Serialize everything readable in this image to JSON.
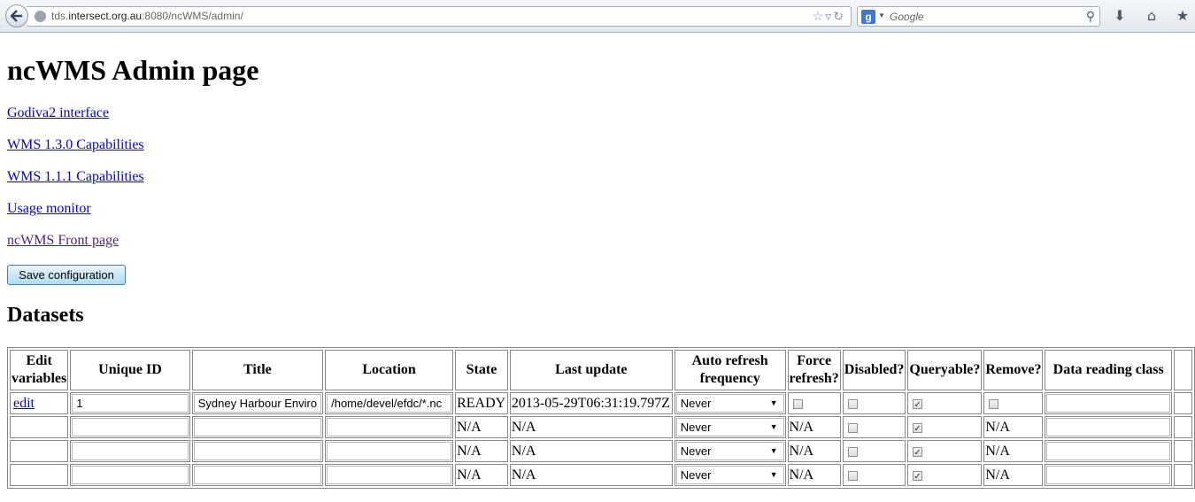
{
  "browser": {
    "url_prefix": "tds.",
    "url_host": "intersect.org.au",
    "url_rest": ":8080/ncWMS/admin/",
    "search_placeholder": "Google",
    "search_engine_letter": "g"
  },
  "page": {
    "title": "ncWMS Admin page",
    "links": [
      {
        "label": "Godiva2 interface"
      },
      {
        "label": "WMS 1.3.0 Capabilities"
      },
      {
        "label": "WMS 1.1.1 Capabilities"
      },
      {
        "label": "Usage monitor"
      },
      {
        "label": "ncWMS Front page"
      }
    ],
    "save_button": "Save configuration",
    "datasets_heading": "Datasets"
  },
  "table": {
    "headers": {
      "edit_line1": "Edit",
      "edit_line2": "variables",
      "unique_id": "Unique ID",
      "title": "Title",
      "location": "Location",
      "state": "State",
      "last_update": "Last update",
      "auto_line1": "Auto refresh",
      "auto_line2": "frequency",
      "force_line1": "Force",
      "force_line2": "refresh?",
      "disabled": "Disabled?",
      "queryable": "Queryable?",
      "remove": "Remove?",
      "data_class": "Data reading class"
    },
    "rows": [
      {
        "edit": "edit",
        "unique_id": "1",
        "title": "Sydney Harbour Enviro",
        "location": "/home/devel/efdc/*.nc",
        "state": "READY",
        "last_update": "2013-05-29T06:31:19.797Z",
        "refresh": "Never",
        "force": "",
        "disabled": false,
        "queryable": true,
        "remove": ""
      },
      {
        "edit": "",
        "unique_id": "",
        "title": "",
        "location": "",
        "state": "N/A",
        "last_update": "N/A",
        "refresh": "Never",
        "force": "N/A",
        "disabled": false,
        "queryable": true,
        "remove": "N/A"
      },
      {
        "edit": "",
        "unique_id": "",
        "title": "",
        "location": "",
        "state": "N/A",
        "last_update": "N/A",
        "refresh": "Never",
        "force": "N/A",
        "disabled": false,
        "queryable": true,
        "remove": "N/A"
      },
      {
        "edit": "",
        "unique_id": "",
        "title": "",
        "location": "",
        "state": "N/A",
        "last_update": "N/A",
        "refresh": "Never",
        "force": "N/A",
        "disabled": false,
        "queryable": true,
        "remove": "N/A"
      }
    ]
  }
}
